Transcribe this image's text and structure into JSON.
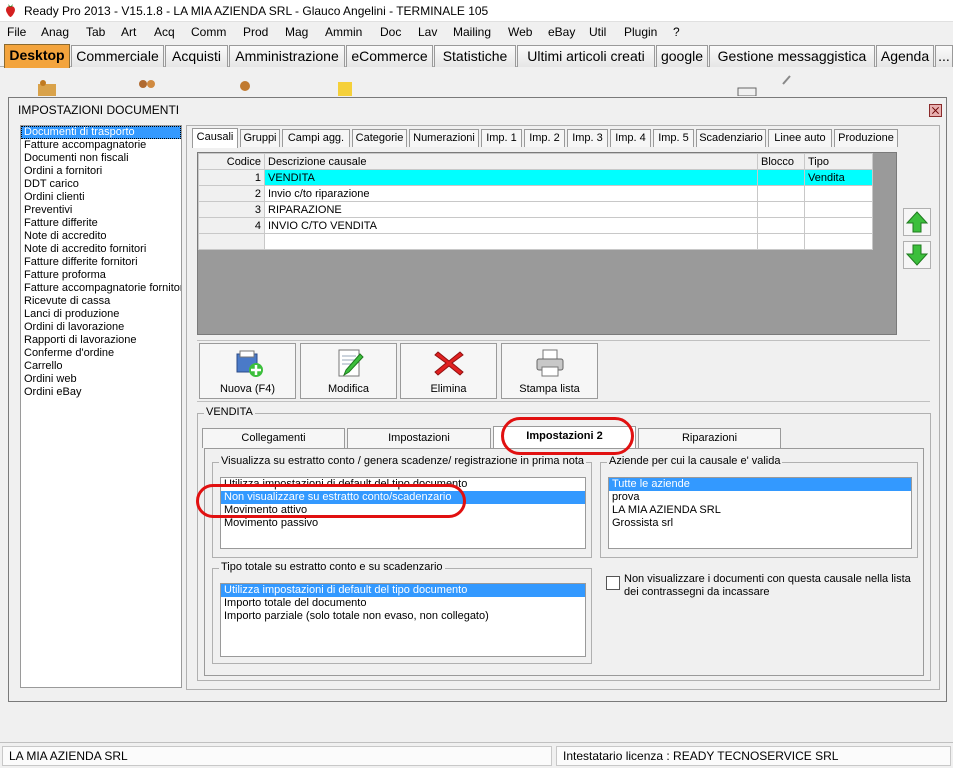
{
  "window": {
    "title": "Ready Pro 2013 - V15.1.8 - LA MIA AZIENDA SRL - Glauco Angelini - TERMINALE 105"
  },
  "menu": [
    "File",
    "Anag",
    "Tab",
    "Art",
    "Acq",
    "Comm",
    "Prod",
    "Mag",
    "Ammin",
    "Doc",
    "Lav",
    "Mailing",
    "Web",
    "eBay",
    "Util",
    "Plugin",
    "?"
  ],
  "top_tabs": [
    "Desktop",
    "Commerciale",
    "Acquisti",
    "Amministrazione",
    "eCommerce",
    "Statistiche",
    "Ultimi articoli creati",
    "google",
    "Gestione messaggistica",
    "Agenda",
    "..."
  ],
  "dialog": {
    "title": "IMPOSTAZIONI DOCUMENTI",
    "doc_types": [
      "Documenti di trasporto",
      "Fatture accompagnatorie",
      "Documenti non fiscali",
      "Ordini a fornitori",
      "DDT carico",
      "Ordini clienti",
      "Preventivi",
      "Fatture differite",
      "Note di accredito",
      "Note di accredito fornitori",
      "Fatture differite fornitori",
      "Fatture proforma",
      "Fatture accompagnatorie fornitori",
      "Ricevute di cassa",
      "Lanci di produzione",
      "Ordini di lavorazione",
      "Rapporti di lavorazione",
      "Conferme d'ordine",
      "Carrello",
      "Ordini web",
      "Ordini eBay"
    ],
    "sub_tabs": [
      "Causali",
      "Gruppi",
      "Campi agg.",
      "Categorie",
      "Numerazioni",
      "Imp. 1",
      "Imp. 2",
      "Imp. 3",
      "Imp. 4",
      "Imp. 5",
      "Scadenziario",
      "Linee auto",
      "Produzione"
    ],
    "grid": {
      "columns": [
        "Codice",
        "Descrizione causale",
        "Blocco",
        "Tipo"
      ],
      "rows": [
        {
          "code": "1",
          "desc": "VENDITA",
          "blocco": "",
          "tipo": "Vendita"
        },
        {
          "code": "2",
          "desc": "Invio c/to riparazione",
          "blocco": "",
          "tipo": ""
        },
        {
          "code": "3",
          "desc": "RIPARAZIONE",
          "blocco": "",
          "tipo": ""
        },
        {
          "code": "4",
          "desc": "INVIO C/TO VENDITA",
          "blocco": "",
          "tipo": ""
        }
      ]
    },
    "toolbar": {
      "new": "Nuova (F4)",
      "edit": "Modifica",
      "delete": "Elimina",
      "print": "Stampa lista"
    },
    "group_title": "VENDITA",
    "inner_tabs": [
      "Collegamenti",
      "Impostazioni",
      "Impostazioni 2",
      "Riparazioni"
    ],
    "statement_group": {
      "legend": "Visualizza su estratto conto / genera scadenze/ registrazione  in prima nota",
      "options": [
        "Utilizza impostazioni di default del tipo documento",
        "Non visualizzare su estratto conto/scadenzario",
        "Movimento attivo",
        "Movimento passivo"
      ]
    },
    "companies_group": {
      "legend": "Aziende per cui la causale e' valida",
      "options": [
        "Tutte le aziende",
        "prova",
        "LA MIA AZIENDA SRL",
        "Grossista srl"
      ]
    },
    "total_group": {
      "legend": "Tipo totale su estratto conto e su scadenzario",
      "options": [
        "Utilizza impostazioni di default del tipo documento",
        "Importo totale del documento",
        "Importo parziale (solo totale non evaso, non collegato)"
      ]
    },
    "checkbox_label": "Non visualizzare i documenti con questa causale nella lista dei contrassegni da incassare"
  },
  "status": {
    "company": "LA MIA AZIENDA SRL",
    "license": "Intestatario licenza : READY TECNOSERVICE SRL"
  }
}
